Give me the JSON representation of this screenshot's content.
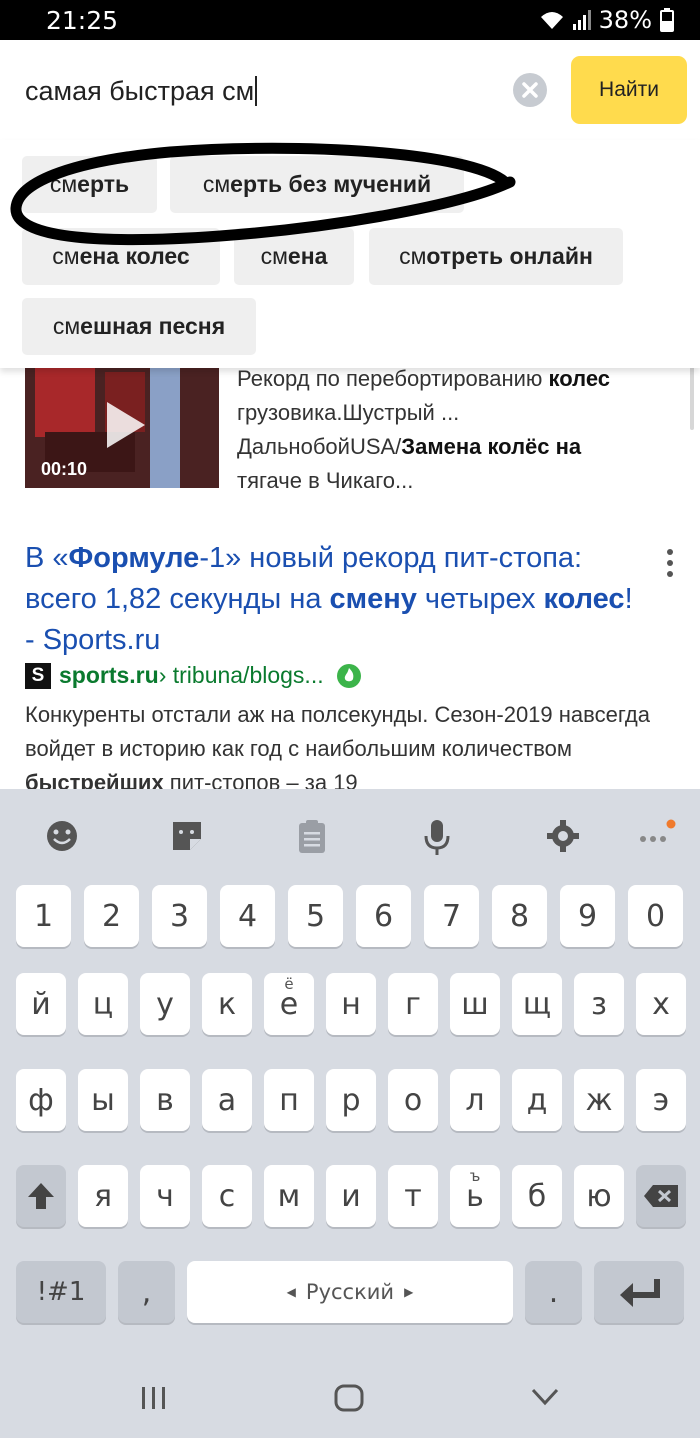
{
  "status_bar": {
    "time": "21:25",
    "battery": "38%"
  },
  "search": {
    "query": "самая быстрая см",
    "find_button": "Найти"
  },
  "suggestions": [
    {
      "prefix": "см",
      "rest": "ерть"
    },
    {
      "prefix": "см",
      "rest": "ерть без мучений"
    },
    {
      "prefix": "см",
      "rest": "ена колес"
    },
    {
      "prefix": "см",
      "rest": "ена"
    },
    {
      "prefix": "см",
      "rest": "отреть онлайн"
    },
    {
      "prefix": "см",
      "rest": "ешная песня"
    }
  ],
  "video_result": {
    "duration": "00:10",
    "line1_a": "Рекорд по перебортированию ",
    "line1_b": "колес",
    "line2": "грузовика.Шустрый ...",
    "line3_a": "ДальнобойUSA/",
    "line3_b": "Замена колёс на",
    "line4": "тягаче в Чикаго..."
  },
  "result": {
    "title_a": "В «",
    "title_b": "Формуле",
    "title_c": "-1» новый рекорд пит-стопа: всего 1,82 секунды на ",
    "title_d": "смену",
    "title_e": " четырех ",
    "title_f": "колес",
    "title_g": "! - Sports.ru",
    "favicon": "S",
    "url_host": "sports.ru",
    "url_path": " › tribuna/blogs...",
    "snippet_a": "Конкуренты отстали аж на полсекунды. Сезон-2019 навсегда войдет в историю как год с наибольшим количеством ",
    "snippet_b": "быстрейших",
    "snippet_c": " пит-стопов – за 19"
  },
  "keyboard": {
    "numbers": [
      "1",
      "2",
      "3",
      "4",
      "5",
      "6",
      "7",
      "8",
      "9",
      "0"
    ],
    "row1": [
      "й",
      "ц",
      "у",
      "к",
      "е",
      "н",
      "г",
      "ш",
      "щ",
      "з",
      "х"
    ],
    "row1_alt_e": "ё",
    "row2": [
      "ф",
      "ы",
      "в",
      "а",
      "п",
      "р",
      "о",
      "л",
      "д",
      "ж",
      "э"
    ],
    "row3": [
      "я",
      "ч",
      "с",
      "м",
      "и",
      "т",
      "ь",
      "б",
      "ю"
    ],
    "row3_alt_soft": "ъ",
    "symbols_key": "!#1",
    "comma": ",",
    "language": "Русский",
    "period": "."
  },
  "colors": {
    "link": "#1a4fb0",
    "url_green": "#0a7a2e",
    "find_yellow": "#ffdb4d",
    "keyboard_bg": "#d7dbe2"
  }
}
